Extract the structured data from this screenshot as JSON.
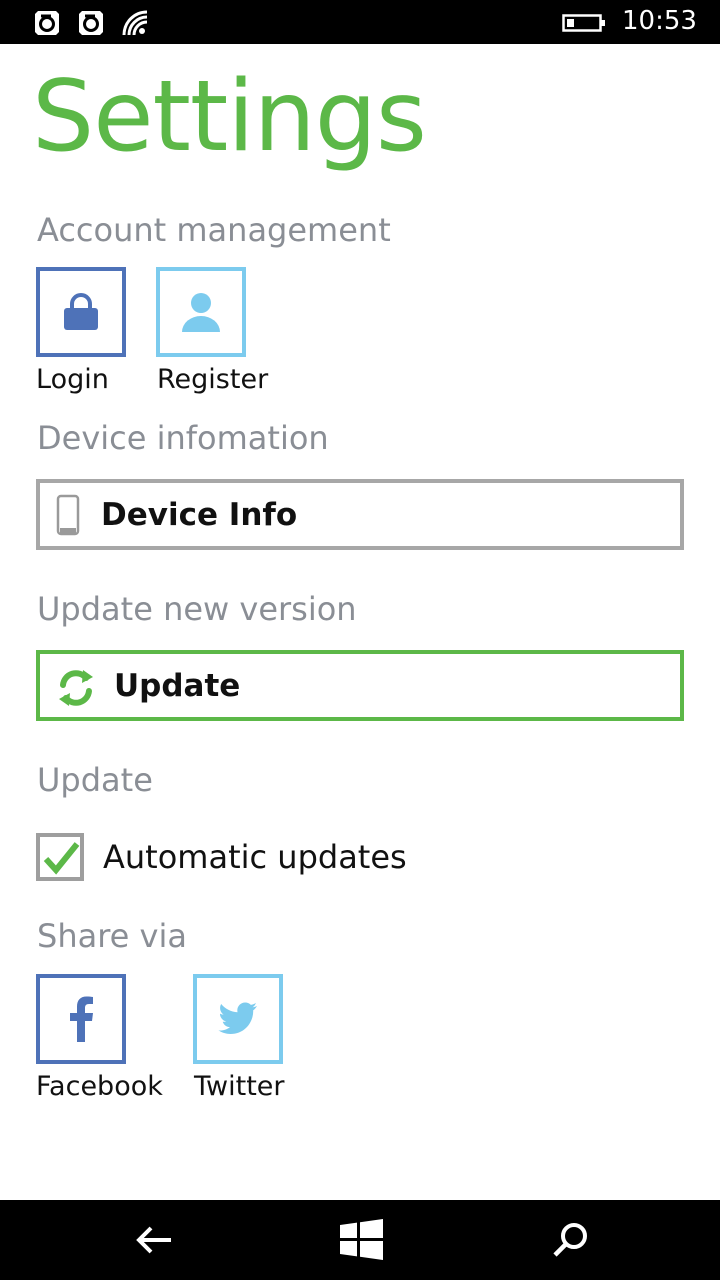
{
  "status_bar": {
    "time": "10:53",
    "icons": [
      "notification-icon",
      "notification-icon",
      "wifi-icon",
      "battery-icon"
    ]
  },
  "page": {
    "title": "Settings"
  },
  "account": {
    "heading": "Account management",
    "login_label": "Login",
    "register_label": "Register",
    "login_color": "#4e72b8",
    "register_color": "#7ccbee"
  },
  "device": {
    "heading": "Device infomation",
    "button_label": "Device Info"
  },
  "update_version": {
    "heading": "Update new version",
    "button_label": "Update",
    "accent": "#5cb848"
  },
  "update": {
    "heading": "Update",
    "auto_label": "Automatic updates",
    "auto_checked": true
  },
  "share": {
    "heading": "Share via",
    "facebook_label": "Facebook",
    "twitter_label": "Twitter"
  },
  "nav": {
    "icons": [
      "back-arrow-icon",
      "windows-start-icon",
      "search-icon"
    ]
  }
}
